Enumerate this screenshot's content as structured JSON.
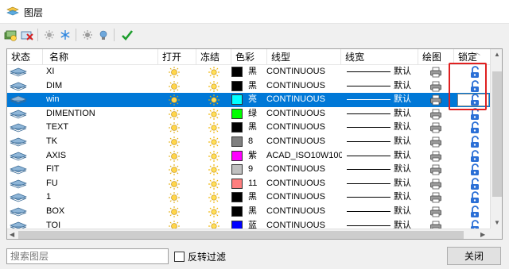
{
  "window": {
    "title": "图层"
  },
  "toolbar": {
    "buttons": [
      {
        "icon": "new-layer-icon"
      },
      {
        "icon": "delete-layer-icon"
      },
      {
        "icon": "freeze-all-icon"
      },
      {
        "icon": "snowflake-icon"
      },
      {
        "icon": "sun-icon"
      },
      {
        "icon": "bulb-icon"
      },
      {
        "icon": "checkmark-icon"
      }
    ]
  },
  "table": {
    "columns": [
      "状态",
      "名称",
      "打开",
      "冻结",
      "色彩",
      "线型",
      "线宽",
      "绘图",
      "锁定"
    ],
    "rows": [
      {
        "name": "XI",
        "color": "#000000",
        "color_name": "黑",
        "linetype": "CONTINUOUS",
        "lineweight": "默认",
        "selected": false
      },
      {
        "name": "DIM",
        "color": "#000000",
        "color_name": "黑",
        "linetype": "CONTINUOUS",
        "lineweight": "默认",
        "selected": false
      },
      {
        "name": "win",
        "color": "#00ffff",
        "color_name": "亮",
        "linetype": "CONTINUOUS",
        "lineweight": "默认",
        "selected": true
      },
      {
        "name": "DIMENTION",
        "color": "#00ff00",
        "color_name": "绿",
        "linetype": "CONTINUOUS",
        "lineweight": "默认",
        "selected": false
      },
      {
        "name": "TEXT",
        "color": "#000000",
        "color_name": "黑",
        "linetype": "CONTINUOUS",
        "lineweight": "默认",
        "selected": false
      },
      {
        "name": "TK",
        "color": "#808080",
        "color_name": "8",
        "linetype": "CONTINUOUS",
        "lineweight": "默认",
        "selected": false
      },
      {
        "name": "AXIS",
        "color": "#ff00ff",
        "color_name": "紫",
        "linetype": "ACAD_ISO10W100",
        "lineweight": "默认",
        "selected": false
      },
      {
        "name": "FIT",
        "color": "#c0c0c0",
        "color_name": "9",
        "linetype": "CONTINUOUS",
        "lineweight": "默认",
        "selected": false
      },
      {
        "name": "FU",
        "color": "#ff7f7f",
        "color_name": "11",
        "linetype": "CONTINUOUS",
        "lineweight": "默认",
        "selected": false
      },
      {
        "name": "1",
        "color": "#000000",
        "color_name": "黑",
        "linetype": "CONTINUOUS",
        "lineweight": "默认",
        "selected": false
      },
      {
        "name": "BOX",
        "color": "#000000",
        "color_name": "黑",
        "linetype": "CONTINUOUS",
        "lineweight": "默认",
        "selected": false
      },
      {
        "name": "TOI",
        "color": "#0000ff",
        "color_name": "蓝",
        "linetype": "CONTINUOUS",
        "lineweight": "默认",
        "selected": false
      }
    ]
  },
  "footer": {
    "search_placeholder": "搜索图层",
    "invert_filter_label": "反转过滤",
    "close_label": "关闭"
  },
  "colors": {
    "selection": "#0078d7",
    "highlight_box": "#e02020",
    "lock_icon": "#2a6fd6"
  }
}
